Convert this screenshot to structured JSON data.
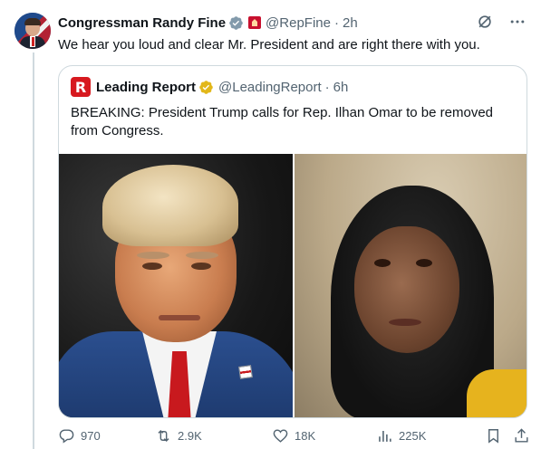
{
  "author": {
    "name": "Congressman Randy Fine",
    "handle": "@RepFine",
    "time": "2h",
    "separator": "·"
  },
  "tweet": {
    "text": "We hear you loud and clear Mr. President and are right there with you."
  },
  "quote": {
    "name": "Leading Report",
    "handle": "@LeadingReport",
    "time": "6h",
    "separator": "·",
    "logo_letter": "R",
    "text": "BREAKING: President Trump calls for Rep. Ilhan Omar to be removed from Congress."
  },
  "actions": {
    "reply_count": "970",
    "retweet_count": "2.9K",
    "like_count": "18K",
    "views_count": "225K"
  },
  "colors": {
    "verified_blue": "#1d9bf0",
    "verified_gold": "#e2b719",
    "muted_text": "#536471",
    "brand_red": "#d7191f"
  },
  "icons": {
    "verified": "verified-badge-icon",
    "affiliate": "house-seal-icon",
    "grok": "grok-icon",
    "more": "more-icon",
    "reply": "reply-icon",
    "retweet": "retweet-icon",
    "like": "heart-icon",
    "views": "views-icon",
    "bookmark": "bookmark-icon",
    "share": "share-icon"
  }
}
